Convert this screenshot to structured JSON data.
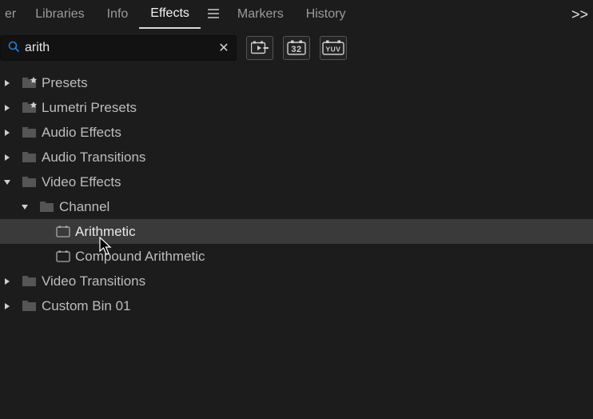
{
  "tabs": {
    "t0": "er",
    "t1": "Libraries",
    "t2": "Info",
    "t3": "Effects",
    "t4": "Markers",
    "t5": "History",
    "overflow": ">>"
  },
  "search": {
    "value": "arith",
    "placeholder": "Search",
    "clear": "✕"
  },
  "toolbar": {
    "btn1_label": "new-bin",
    "btn2_label": "32",
    "btn3_label": "YUV"
  },
  "tree": {
    "presets": "Presets",
    "lumetri": "Lumetri Presets",
    "audio_fx": "Audio Effects",
    "audio_tr": "Audio Transitions",
    "video_fx": "Video Effects",
    "channel": "Channel",
    "arith": "Arithmetic",
    "compound": "Compound Arithmetic",
    "video_tr": "Video Transitions",
    "custom": "Custom Bin 01"
  }
}
